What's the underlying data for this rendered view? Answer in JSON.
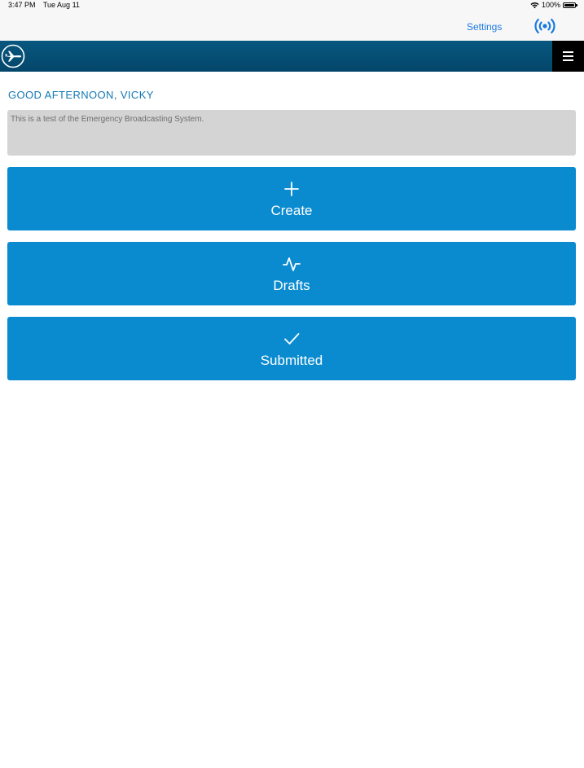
{
  "status_bar": {
    "time": "3:47 PM",
    "date": "Tue Aug 11",
    "battery_text": "100%",
    "battery_level": 1.0
  },
  "top_bar": {
    "settings_label": "Settings",
    "broadcast_icon": "broadcast-icon",
    "accent_color": "#1a7ae0"
  },
  "nav": {
    "logo_icon": "airplane-logo-icon",
    "menu_icon": "hamburger-menu-icon",
    "background_color": "#04466a"
  },
  "greeting": "GOOD AFTERNOON, VICKY",
  "message": "This is a test of the Emergency Broadcasting System.",
  "actions": [
    {
      "label": "Create",
      "icon": "plus-icon"
    },
    {
      "label": "Drafts",
      "icon": "activity-icon"
    },
    {
      "label": "Submitted",
      "icon": "checkmark-icon"
    }
  ],
  "colors": {
    "greeting": "#1478b4",
    "button": "#0a8bd0",
    "message_box": "#d4d4d4"
  }
}
